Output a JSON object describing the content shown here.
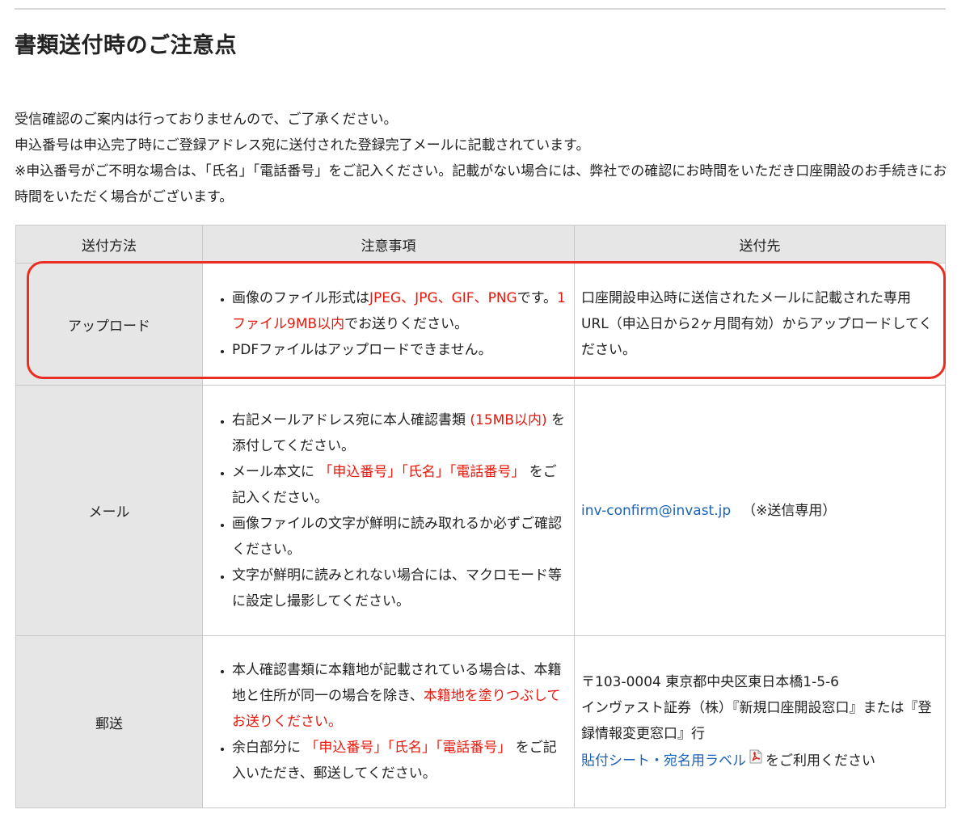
{
  "heading": "書類送付時のご注意点",
  "intro": {
    "line1": "受信確認のご案内は行っておりませんので、ご了承ください。",
    "line2": "申込番号は申込完了時にご登録アドレス宛に送付された登録完了メールに記載されています。",
    "line3": "※申込番号がご不明な場合は、「氏名」「電話番号」をご記入ください。記載がない場合には、弊社での確認にお時間をいただき口座開設のお手続きにお時間をいただく場合がございます。"
  },
  "table": {
    "headers": {
      "method": "送付方法",
      "notes": "注意事項",
      "destination": "送付先"
    },
    "upload": {
      "method": "アップロード",
      "note1": {
        "a": "画像のファイル形式は",
        "red1": "JPEG、JPG、GIF、PNG",
        "b": "です。",
        "red2": "1ファイル9MB以内",
        "c": "でお送りください。"
      },
      "note2": "PDFファイルはアップロードできません。",
      "destination": "口座開設申込時に送信されたメールに記載された専用URL（申込日から2ヶ月間有効）からアップロードしてください。"
    },
    "mail": {
      "method": "メール",
      "note1": {
        "a": "右記メールアドレス宛に本人確認書類 ",
        "red": "(15MB以内)",
        "b": " を添付してください。"
      },
      "note2": {
        "a": "メール本文に ",
        "red": "「申込番号」「氏名」「電話番号」",
        "b": " をご記入ください。"
      },
      "note3": "画像ファイルの文字が鮮明に読み取れるか必ずご確認ください。",
      "note4": "文字が鮮明に読みとれない場合には、マクロモード等に設定し撮影してください。",
      "email": "inv-confirm@invast.jp",
      "email_note": "（※送信専用）"
    },
    "post": {
      "method": "郵送",
      "note1": {
        "a": "本人確認書類に本籍地が記載されている場合は、本籍地と住所が同一の場合を除き、",
        "red": "本籍地を塗りつぶしてお送りください。"
      },
      "note2": {
        "a": "余白部分に ",
        "red": "「申込番号」「氏名」「電話番号」",
        "b": " をご記入いただき、郵送してください。"
      },
      "address1": "〒103-0004 東京都中央区東日本橋1-5-6",
      "address2": "インヴァスト証券（株）『新規口座開設窓口』または『登録情報変更窓口』行",
      "label_link": "貼付シート・宛名用ラベル",
      "label_suffix": "をご利用ください"
    }
  },
  "colors": {
    "accent_red": "#e8170b",
    "link_blue": "#1a62b8",
    "highlight_border": "#ea2d20",
    "header_bg": "#e6e6e6"
  },
  "icons": {
    "pdf": "pdf-file-icon"
  }
}
